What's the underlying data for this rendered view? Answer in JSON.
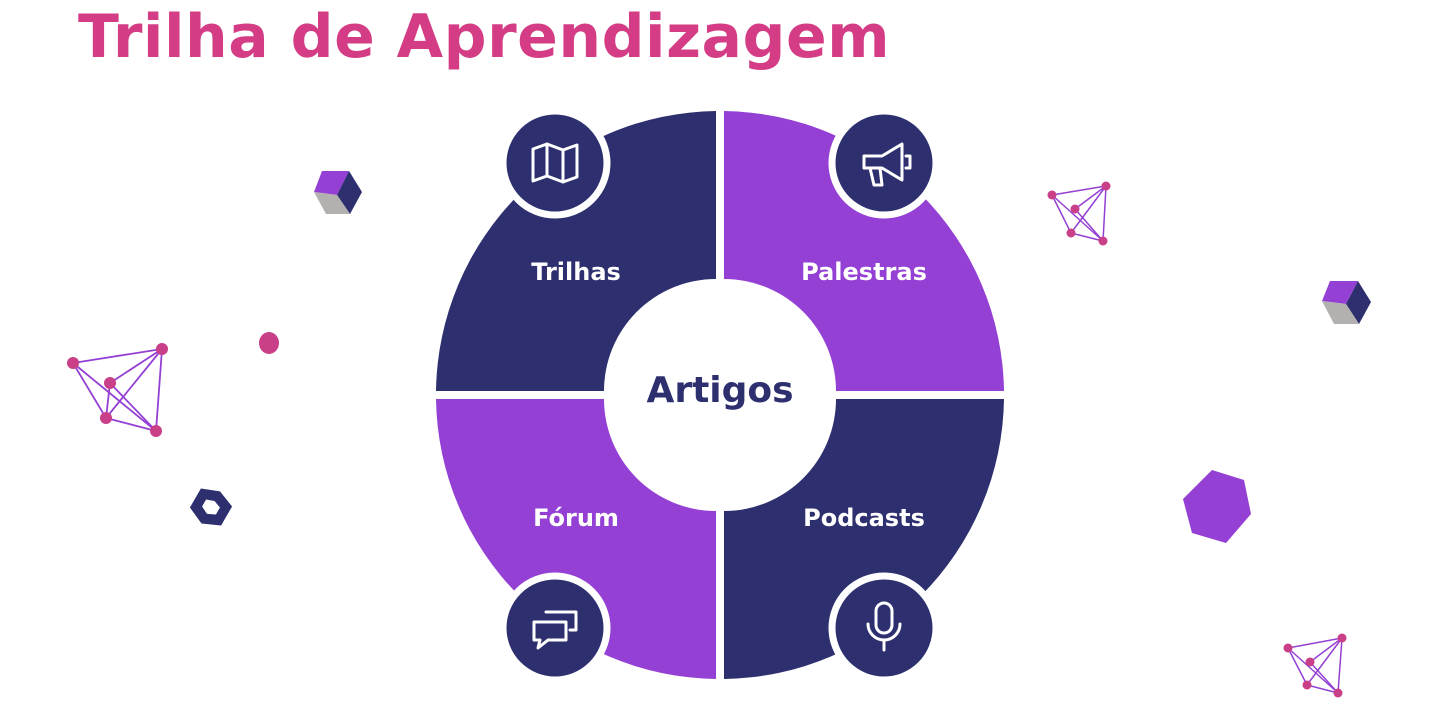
{
  "title": "Trilha de Aprendizagem",
  "center": {
    "label": "Artigos"
  },
  "segments": [
    {
      "label": "Trilhas",
      "icon": "map-icon",
      "color": "#2d2f6f"
    },
    {
      "label": "Palestras",
      "icon": "megaphone-icon",
      "color": "#9440d4"
    },
    {
      "label": "Fórum",
      "icon": "chat-bubbles-icon",
      "color": "#9440d4"
    },
    {
      "label": "Podcasts",
      "icon": "microphone-icon",
      "color": "#2d2f6f"
    }
  ],
  "colors": {
    "title": "#d43d86",
    "navy": "#2d2f6f",
    "purple": "#9440d4",
    "pink_accent": "#c93f88",
    "grey": "#b3b1b0"
  }
}
